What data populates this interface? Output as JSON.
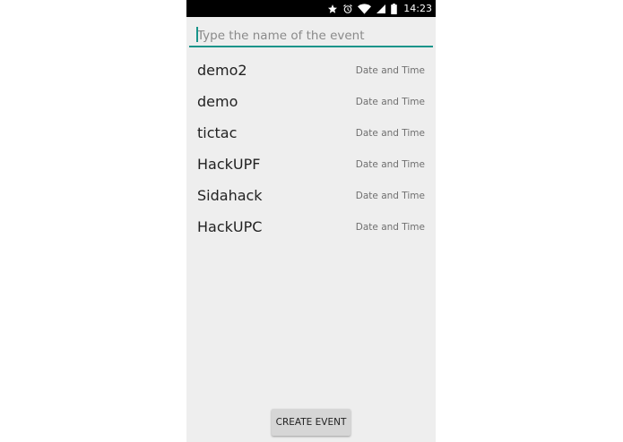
{
  "status_bar": {
    "time": "14:23",
    "icons": [
      "star-icon",
      "alarm-icon",
      "wifi-icon",
      "signal-icon",
      "battery-icon"
    ],
    "background_color": "#000000"
  },
  "search": {
    "placeholder": "Type the name of the event",
    "value": "",
    "accent_color": "#17948a"
  },
  "events": [
    {
      "name": "demo2",
      "datetime": "Date and Time"
    },
    {
      "name": "demo",
      "datetime": "Date and Time"
    },
    {
      "name": "tictac",
      "datetime": "Date and Time"
    },
    {
      "name": "HackUPF",
      "datetime": "Date and Time"
    },
    {
      "name": "Sidahack",
      "datetime": "Date and Time"
    },
    {
      "name": "HackUPC",
      "datetime": "Date and Time"
    }
  ],
  "create_button": {
    "label": "CREATE EVENT"
  }
}
